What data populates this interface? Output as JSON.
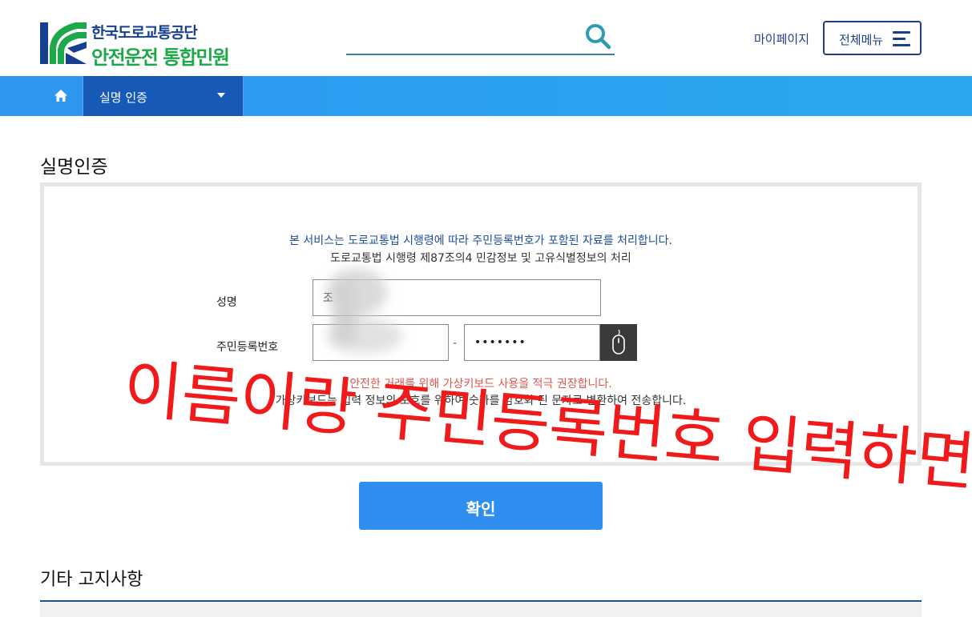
{
  "header": {
    "logo_line1": "한국도로교통공단",
    "logo_line2": "안전운전 통합민원",
    "search_placeholder": "",
    "mypage_label": "마이페이지",
    "allmenu_label": "전체메뉴"
  },
  "nav": {
    "home_icon": "home-icon",
    "selected_label": "실명 인증"
  },
  "section": {
    "title": "실명인증",
    "notice_line1": "본 서비스는 도로교통법 시행령에 따라 주민등록번호가 포함된 자료를 처리합니다.",
    "notice_line2": "도로교통법 시행령 제87조의4 민감정보 및 고유식별정보의 처리",
    "name_label": "성명",
    "name_value": "조",
    "rrn_label": "주민등록번호",
    "rrn_dash": "-",
    "rrn_back_value": "•••••••",
    "warning_line1": "안전한 거래를 위해 가상키보드 사용을 적극 권장합니다.",
    "warning_line2": "가상키보드는 입력 정보의 보호를 위하여 숫자를 암호화 된 문자로 변환하여 전송합니다."
  },
  "overlay": {
    "annotation": "이름이랑 주민등록번호 입력하면~"
  },
  "confirm_label": "확인",
  "other": {
    "title": "기타 고지사항"
  },
  "colors": {
    "brand_blue": "#1b3f8b",
    "brand_green": "#1da84a",
    "nav_blue": "#2e97f0",
    "nav_selected": "#1659b6",
    "button_blue": "#2f8ff0",
    "warning_red": "#e1554f",
    "annotation_red": "#f01a1a"
  }
}
